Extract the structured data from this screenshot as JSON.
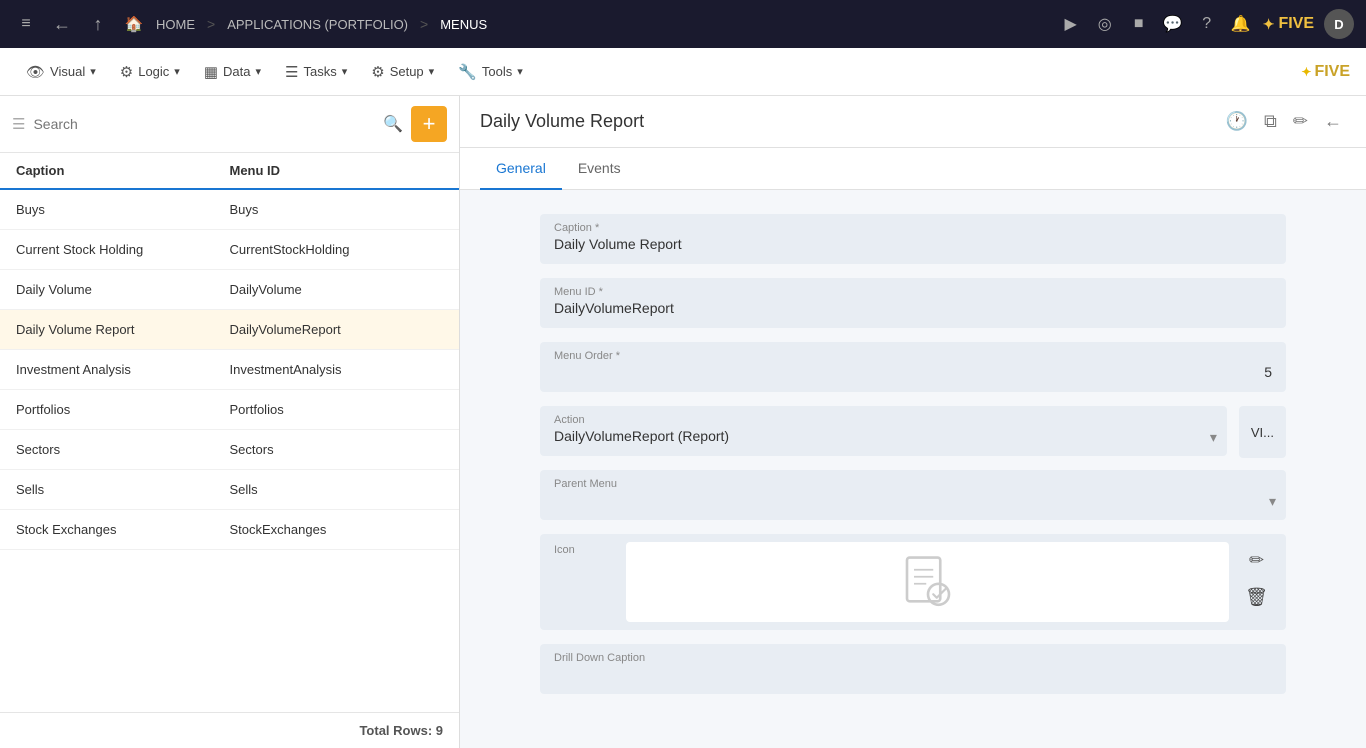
{
  "topnav": {
    "menu_icon": "≡",
    "back_icon": "←",
    "up_icon": "↑",
    "home_label": "HOME",
    "breadcrumb_sep1": ">",
    "breadcrumb_portfolio": "APPLICATIONS (PORTFOLIO)",
    "breadcrumb_sep2": ">",
    "breadcrumb_menus": "MENUS",
    "right_icons": [
      "▶",
      "◎",
      "■",
      "💬",
      "?",
      "🔔"
    ],
    "avatar_label": "D"
  },
  "toolbar": {
    "items": [
      {
        "id": "visual",
        "label": "Visual",
        "icon": "👁"
      },
      {
        "id": "logic",
        "label": "Logic",
        "icon": "⚙"
      },
      {
        "id": "data",
        "label": "Data",
        "icon": "▦"
      },
      {
        "id": "tasks",
        "label": "Tasks",
        "icon": "☰"
      },
      {
        "id": "setup",
        "label": "Setup",
        "icon": "⚙"
      },
      {
        "id": "tools",
        "label": "Tools",
        "icon": "🔧"
      }
    ],
    "brand_label": "FIVE",
    "brand_stars": "✦"
  },
  "search": {
    "placeholder": "Search"
  },
  "table": {
    "columns": [
      "Caption",
      "Menu ID"
    ],
    "rows": [
      {
        "caption": "Buys",
        "menuId": "Buys"
      },
      {
        "caption": "Current Stock Holding",
        "menuId": "CurrentStockHolding"
      },
      {
        "caption": "Daily Volume",
        "menuId": "DailyVolume"
      },
      {
        "caption": "Daily Volume Report",
        "menuId": "DailyVolumeReport",
        "selected": true
      },
      {
        "caption": "Investment Analysis",
        "menuId": "InvestmentAnalysis"
      },
      {
        "caption": "Portfolios",
        "menuId": "Portfolios"
      },
      {
        "caption": "Sectors",
        "menuId": "Sectors"
      },
      {
        "caption": "Sells",
        "menuId": "Sells"
      },
      {
        "caption": "Stock Exchanges",
        "menuId": "StockExchanges"
      }
    ],
    "footer": "Total Rows: 9"
  },
  "detail": {
    "title": "Daily Volume Report",
    "tabs": [
      {
        "id": "general",
        "label": "General",
        "active": true
      },
      {
        "id": "events",
        "label": "Events",
        "active": false
      }
    ],
    "form": {
      "caption_label": "Caption *",
      "caption_value": "Daily Volume Report",
      "menu_id_label": "Menu ID *",
      "menu_id_value": "DailyVolumeReport",
      "menu_order_label": "Menu Order *",
      "menu_order_value": "5",
      "action_label": "Action",
      "action_value": "DailyVolumeReport (Report)",
      "view_btn_label": "VI...",
      "parent_menu_label": "Parent Menu",
      "parent_menu_value": "",
      "icon_label": "Icon",
      "drill_down_label": "Drill Down Caption"
    }
  }
}
